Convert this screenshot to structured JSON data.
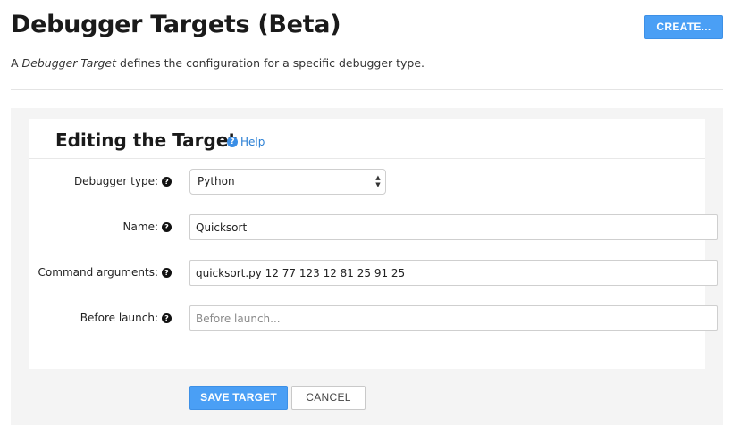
{
  "header": {
    "title": "Debugger Targets (Beta)",
    "create_label": "CREATE...",
    "intro_prefix": "A ",
    "intro_emphasis": "Debugger Target",
    "intro_suffix": " defines the configuration for a specific debugger type."
  },
  "editor": {
    "title": "Editing the Target",
    "help_label": "Help",
    "help_icon": "question-circle-icon"
  },
  "form": {
    "debugger_type": {
      "label": "Debugger type:",
      "value": "Python"
    },
    "name": {
      "label": "Name:",
      "value": "Quicksort",
      "placeholder": ""
    },
    "command_arguments": {
      "label": "Command arguments:",
      "value": "quicksort.py 12 77 123 12 81 25 91 25",
      "placeholder": ""
    },
    "before_launch": {
      "label": "Before launch:",
      "value": "",
      "placeholder": "Before launch..."
    }
  },
  "actions": {
    "save_label": "SAVE TARGET",
    "cancel_label": "CANCEL"
  },
  "colors": {
    "accent": "#4a9ff5",
    "link": "#2a7fd4",
    "panel_bg": "#f4f4f4"
  }
}
